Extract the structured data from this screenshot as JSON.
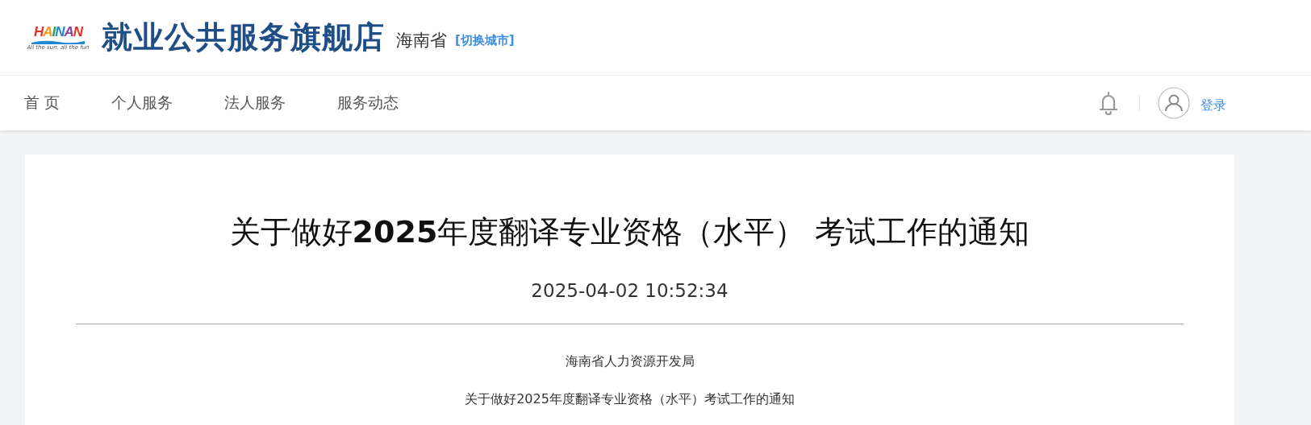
{
  "header": {
    "logo": {
      "word": "HAINAN",
      "tagline": "All the sun, all the fun"
    },
    "site_title": "就业公共服务旗舰店",
    "province": "海南省",
    "switch_city": "[切换城市]"
  },
  "nav": {
    "items": [
      "首 页",
      "个人服务",
      "法人服务",
      "服务动态"
    ],
    "login": "登录"
  },
  "article": {
    "title": "关于做好**2025**年度翻译专业资格（水平） 考试工作的通知",
    "date": "2025-04-02 10:52:34",
    "paragraphs": [
      "海南省人力资源开发局",
      "关于做好2025年度翻译专业资格（水平）考试工作的通知"
    ]
  }
}
